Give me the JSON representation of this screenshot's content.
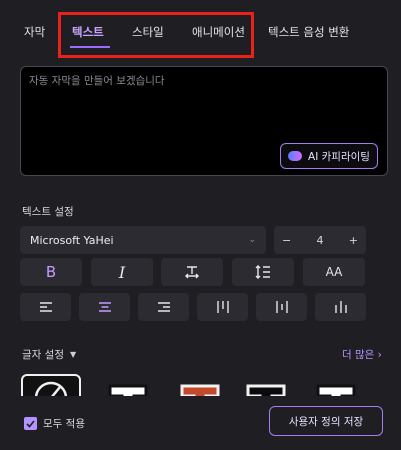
{
  "tabs": [
    {
      "label": "자막"
    },
    {
      "label": "텍스트",
      "active": true
    },
    {
      "label": "스타일"
    },
    {
      "label": "애니메이션"
    },
    {
      "label": "텍스트 음성 변환"
    }
  ],
  "text_input": {
    "placeholder": "자동 자막을 만들어 보겠습니다"
  },
  "ai_copywriting": {
    "label": "AI 카피라이팅"
  },
  "text_settings": {
    "label": "텍스트 설정",
    "font": "Microsoft YaHei",
    "size": "4",
    "minus": "−",
    "plus": "+"
  },
  "format_buttons": {
    "bold": "B",
    "italic": "I",
    "case": "AA"
  },
  "caption_settings": {
    "label": "글자 설정",
    "more": "더 많은"
  },
  "footer": {
    "apply_all": "모두 적용",
    "save_custom": "사용자 정의 저장"
  },
  "colors": {
    "accent": "#b592ff",
    "highlight": "#e8221b",
    "panel": "#1f1f23"
  }
}
